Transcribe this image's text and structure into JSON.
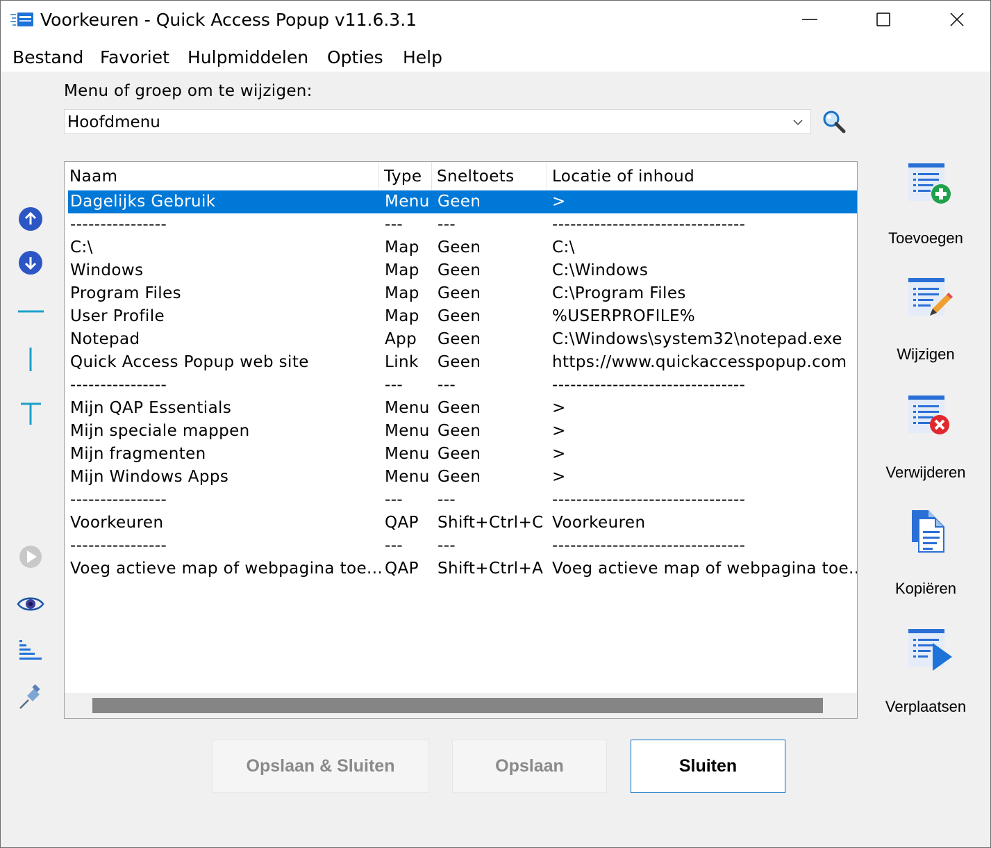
{
  "window": {
    "title": "Voorkeuren - Quick Access Popup v11.6.3.1"
  },
  "menubar": [
    "Bestand",
    "Favoriet",
    "Hulpmiddelen",
    "Opties",
    "Help"
  ],
  "combo": {
    "label": "Menu of groep om te wijzigen:",
    "value": "Hoofdmenu"
  },
  "list": {
    "columns": [
      "Naam",
      "Type",
      "Sneltoets",
      "Locatie of inhoud"
    ],
    "rows": [
      [
        "Dagelijks Gebruik",
        "Menu",
        "Geen",
        ">"
      ],
      [
        "----------------",
        "---",
        "---",
        "--------------------------------"
      ],
      [
        "C:\\",
        "Map",
        "Geen",
        "C:\\"
      ],
      [
        "Windows",
        "Map",
        "Geen",
        "C:\\Windows"
      ],
      [
        "Program Files",
        "Map",
        "Geen",
        "C:\\Program Files"
      ],
      [
        "User Profile",
        "Map",
        "Geen",
        "%USERPROFILE%"
      ],
      [
        "Notepad",
        "App",
        "Geen",
        "C:\\Windows\\system32\\notepad.exe"
      ],
      [
        "Quick Access Popup web site",
        "Link",
        "Geen",
        "https://www.quickaccesspopup.com"
      ],
      [
        "----------------",
        "---",
        "---",
        "--------------------------------"
      ],
      [
        "Mijn QAP Essentials",
        "Menu",
        "Geen",
        ">"
      ],
      [
        "Mijn speciale mappen",
        "Menu",
        "Geen",
        ">"
      ],
      [
        "Mijn fragmenten",
        "Menu",
        "Geen",
        ">"
      ],
      [
        "Mijn Windows Apps",
        "Menu",
        "Geen",
        ">"
      ],
      [
        "----------------",
        "---",
        "---",
        "--------------------------------"
      ],
      [
        "Voorkeuren",
        "QAP",
        "Shift+Ctrl+C",
        "Voorkeuren"
      ],
      [
        "----------------",
        "---",
        "---",
        "--------------------------------"
      ],
      [
        "Voeg actieve map of webpagina toe...",
        "QAP",
        "Shift+Ctrl+A",
        "Voeg actieve map of webpagina toe..."
      ]
    ]
  },
  "right_toolbar": {
    "add": "Toevoegen",
    "edit": "Wijzigen",
    "remove": "Verwijderen",
    "copy": "Kopiëren",
    "move": "Verplaatsen"
  },
  "buttons": {
    "save_close": "Opslaan & Sluiten",
    "save": "Opslaan",
    "close": "Sluiten"
  },
  "colors": {
    "selection": "#0078d7",
    "accent_teal": "#1ba1c9",
    "nav_blue": "#2c56c4",
    "add_green": "#1fa14b",
    "remove_red": "#e0282e"
  }
}
